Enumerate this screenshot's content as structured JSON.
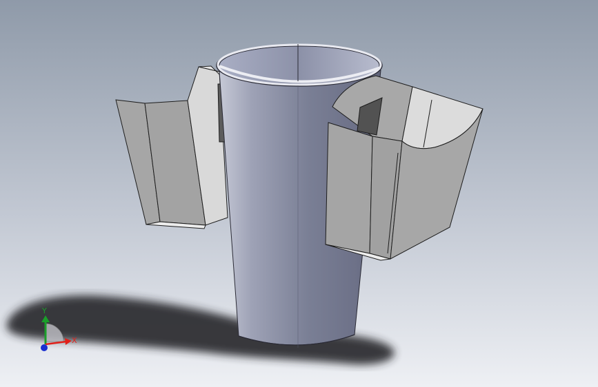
{
  "viewport": {
    "background_top": "#8f9aa9",
    "background_bottom": "#eef0f4"
  },
  "model": {
    "cup_color": "#7e849a",
    "holder_color": "#a4a4a4",
    "holder_light": "#d8d8d8",
    "edge_color": "#1c1c1c"
  },
  "triad": {
    "x_label": "X",
    "y_label": "Y",
    "x_color": "#e0201a",
    "y_color": "#1a9e2a",
    "z_color": "#1a2fd0"
  }
}
